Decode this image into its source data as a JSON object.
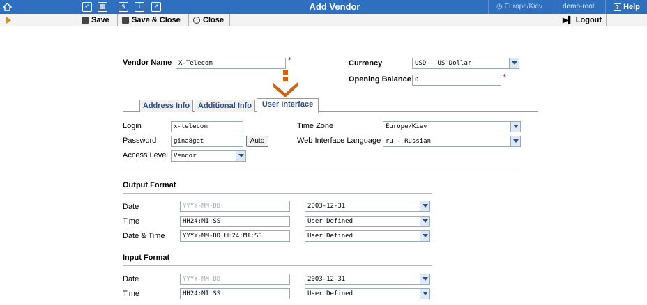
{
  "topbar": {
    "title": "Add Vendor",
    "timezone": "Europe/Kiev",
    "user": "demo-root",
    "help": "Help"
  },
  "toolbar": {
    "save": "Save",
    "save_close": "Save & Close",
    "close": "Close",
    "logout": "Logout"
  },
  "vendor": {
    "name_label": "Vendor Name",
    "name_value": "X-Telecom",
    "currency_label": "Currency",
    "currency_value": "USD - US Dollar",
    "opening_balance_label": "Opening Balance",
    "opening_balance_value": "0"
  },
  "tabs": [
    "Address Info",
    "Additional Info",
    "User Interface"
  ],
  "ui": {
    "login_label": "Login",
    "login_value": "x-telecom",
    "password_label": "Password",
    "password_value": "gina8get",
    "auto_button": "Auto",
    "access_label": "Access Level",
    "access_value": "Vendor",
    "timezone_label": "Time Zone",
    "timezone_value": "Europe/Kiev",
    "language_label": "Web Interface Language",
    "language_value": "ru - Russian"
  },
  "output_format": {
    "title": "Output Format",
    "rows": [
      {
        "label": "Date",
        "value": "YYYY-MM-DD",
        "placeholder": true,
        "select": "2003-12-31"
      },
      {
        "label": "Time",
        "value": "HH24:MI:SS",
        "placeholder": false,
        "select": "User Defined"
      },
      {
        "label": "Date & Time",
        "value": "YYYY-MM-DD HH24:MI:SS",
        "placeholder": false,
        "select": "User Defined"
      }
    ]
  },
  "input_format": {
    "title": "Input Format",
    "rows": [
      {
        "label": "Date",
        "value": "YYYY-MM-DD",
        "placeholder": true,
        "select": "2003-12-31"
      },
      {
        "label": "Time",
        "value": "HH24:MI:SS",
        "placeholder": false,
        "select": "User Defined"
      }
    ]
  },
  "colors": {
    "topbar": "#2f6fc0",
    "tab_text": "#2c4f86",
    "pointer": "#c9661a",
    "required": "#dd0000"
  },
  "required_mark": "*"
}
